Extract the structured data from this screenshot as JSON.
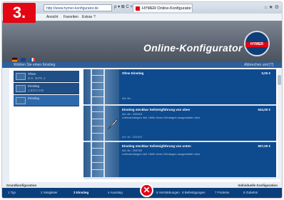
{
  "step_badge": "3.",
  "browser": {
    "address": "http://www.hymer-konfigurator.de",
    "nav_controls": "ρ ▾ ⊠ C ×",
    "tab_title": "HYMER Online-Konfigurator",
    "window_controls": "⌂ ★ ⚙"
  },
  "menu": [
    "Ansicht",
    "Favoriten",
    "Extras",
    "?"
  ],
  "app": {
    "title": "Online-Konfigurator",
    "logo_text": "HYMER",
    "subheader_left": "Wählen Sie einen Einstieg",
    "subheader_right": "Abbrechen und [?]",
    "colors": {
      "accent": "#e30613",
      "primary": "#0e4a8e"
    }
  },
  "options": [
    {
      "title": "Ohne",
      "sub": "B.S. 3079 ,1"
    },
    {
      "title": "Einstieg",
      "sub": "1,5/3,0 mm"
    },
    {
      "title": "Einstieg",
      "sub": ""
    }
  ],
  "products": [
    {
      "name": "Ohne Einstieg",
      "article": "Art.-Nr.:",
      "desc": "",
      "price": "0,00 €",
      "footer": ""
    },
    {
      "name": "Einstieg steckbar Seilsteigführung von oben",
      "article": "Art.-Nr.: 205419",
      "desc": "Leiteranhängen inkl. Hölle eines Gehänges ausgestattet ohne",
      "price": "544,00 €",
      "footer": "Art.-Nr.:      205419"
    },
    {
      "name": "Einstieg steckbar Seilsteigführung von unten",
      "article": "Art.-Nr.: 205762",
      "desc": "Leiteranhängen inkl. Hölle eines Gehänges ausgestattet ohne",
      "price": "607,00 €",
      "footer": ""
    }
  ],
  "footer": {
    "left": "Grundkonfiguration",
    "right": "Individuelle Konfiguration"
  },
  "steps": [
    "1  Typ",
    "2  Steigleiter",
    "3  Einstieg",
    "4  Ausstieg",
    "5  Verstärkungen",
    "6  Befestigungen",
    "7  Podeste",
    "8  Zubehör"
  ]
}
